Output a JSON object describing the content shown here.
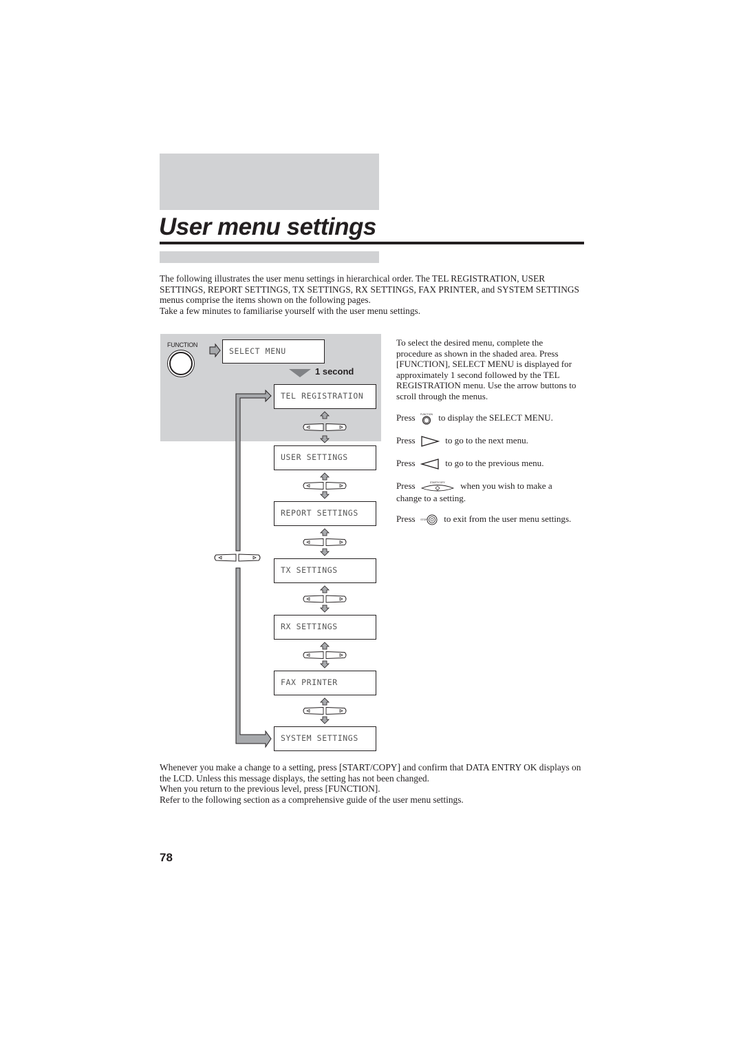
{
  "page": {
    "title": "User menu settings",
    "page_number": "78"
  },
  "intro": {
    "paragraph": "The following illustrates the user menu settings in hierarchical order. The TEL REGISTRATION, USER SETTINGS, REPORT SETTINGS, TX SETTINGS, RX SETTINGS, FAX PRINTER, and SYSTEM SETTINGS menus comprise the items shown on the following pages.",
    "note": "Take a few minutes to familiarise yourself with the user menu settings."
  },
  "diagram": {
    "function_label": "FUNCTION",
    "select_menu": "SELECT MENU",
    "delay_label": "1 second",
    "menus": [
      "TEL REGISTRATION",
      "USER SETTINGS",
      "REPORT SETTINGS",
      "TX SETTINGS",
      "RX SETTINGS",
      "FAX PRINTER",
      "SYSTEM SETTINGS"
    ],
    "icons": {
      "function_button": "function-button-icon",
      "arrow_keys": "left-right-arrow-keys-icon",
      "up_arrow": "up-arrow-icon",
      "down_arrow": "down-arrow-icon",
      "delay_arrow": "down-triangle-icon",
      "loop_arrow": "loop-arrow-icon"
    },
    "colors": {
      "shade": "#d1d2d4",
      "arrow_fill": "#a7a9ac",
      "ink": "#231f20"
    }
  },
  "instructions": {
    "description": "To select the desired menu, complete the procedure as shown in the shaded area. Press [FUNCTION], SELECT MENU is displayed for approximately 1 second followed by the TEL REGISTRATION menu. Use the arrow buttons to scroll through the menus.",
    "press_word": "Press",
    "function_text": "to display the SELECT MENU.",
    "next_text": "to go to the next menu.",
    "prev_text": "to go to the previous menu.",
    "start_text": "when you wish to make a change to a setting.",
    "stop_text": "to exit from the user menu settings.",
    "icon_labels": {
      "function": "FUNCTION",
      "start": "START/COPY",
      "stop": "STOP"
    }
  },
  "footer_text": {
    "line1": "Whenever you make a change to a setting, press [START/COPY] and confirm that DATA ENTRY OK displays on the LCD. Unless this message displays, the setting has not been changed.",
    "line2": "When you return to the previous level, press [FUNCTION].",
    "line3": "Refer to the following section as a comprehensive guide of the user menu settings."
  }
}
